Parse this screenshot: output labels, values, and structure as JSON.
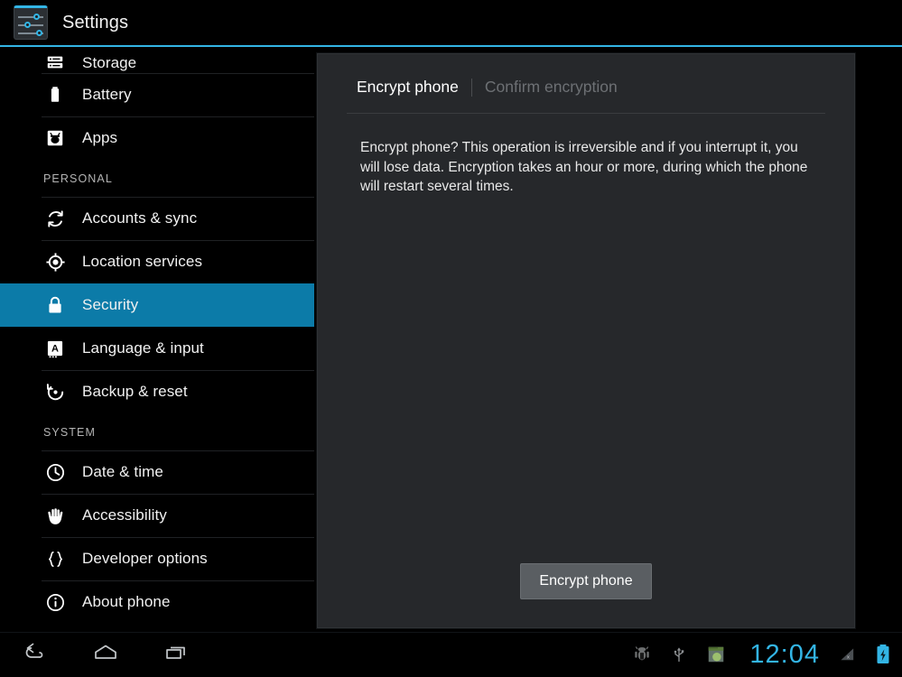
{
  "app": {
    "title": "Settings",
    "icon": "settings-sliders-icon",
    "accent_color": "#33b5e5",
    "background_color": "#000000"
  },
  "sidebar": {
    "items": [
      {
        "label": "Storage",
        "icon": "storage-icon",
        "selected": false,
        "partial": true
      },
      {
        "label": "Battery",
        "icon": "battery-icon",
        "selected": false,
        "partial": false
      },
      {
        "label": "Apps",
        "icon": "apps-icon",
        "selected": false,
        "partial": false
      }
    ],
    "sections": [
      {
        "header": "PERSONAL",
        "items": [
          {
            "label": "Accounts & sync",
            "icon": "sync-icon",
            "selected": false
          },
          {
            "label": "Location services",
            "icon": "location-icon",
            "selected": false
          },
          {
            "label": "Security",
            "icon": "lock-icon",
            "selected": true
          },
          {
            "label": "Language & input",
            "icon": "language-icon",
            "selected": false
          },
          {
            "label": "Backup & reset",
            "icon": "backup-icon",
            "selected": false
          }
        ]
      },
      {
        "header": "SYSTEM",
        "items": [
          {
            "label": "Date & time",
            "icon": "clock-icon",
            "selected": false
          },
          {
            "label": "Accessibility",
            "icon": "hand-icon",
            "selected": false
          },
          {
            "label": "Developer options",
            "icon": "braces-icon",
            "selected": false
          },
          {
            "label": "About phone",
            "icon": "info-icon",
            "selected": false
          }
        ]
      }
    ],
    "selected_color": "#0c7ba8"
  },
  "content": {
    "tabs": [
      {
        "label": "Encrypt phone",
        "active": true
      },
      {
        "label": "Confirm encryption",
        "active": false
      }
    ],
    "body": "Encrypt phone? This operation is irreversible and if you interrupt it, you will lose data. Encryption takes an hour or more, during which the phone will restart several times.",
    "action_button": "Encrypt phone"
  },
  "system_bar": {
    "buttons": [
      {
        "label": "Back",
        "icon": "back-arrow-icon"
      },
      {
        "label": "Home",
        "icon": "home-icon"
      },
      {
        "label": "Recent apps",
        "icon": "recent-apps-icon"
      }
    ],
    "status_icons": [
      {
        "name": "adb-debug-icon"
      },
      {
        "name": "usb-icon"
      },
      {
        "name": "app-notification-icon"
      }
    ],
    "clock": "12:04",
    "signal": {
      "icon": "signal-no-service-icon"
    },
    "battery": {
      "icon": "battery-charging-icon",
      "color": "#33b5e5"
    }
  }
}
